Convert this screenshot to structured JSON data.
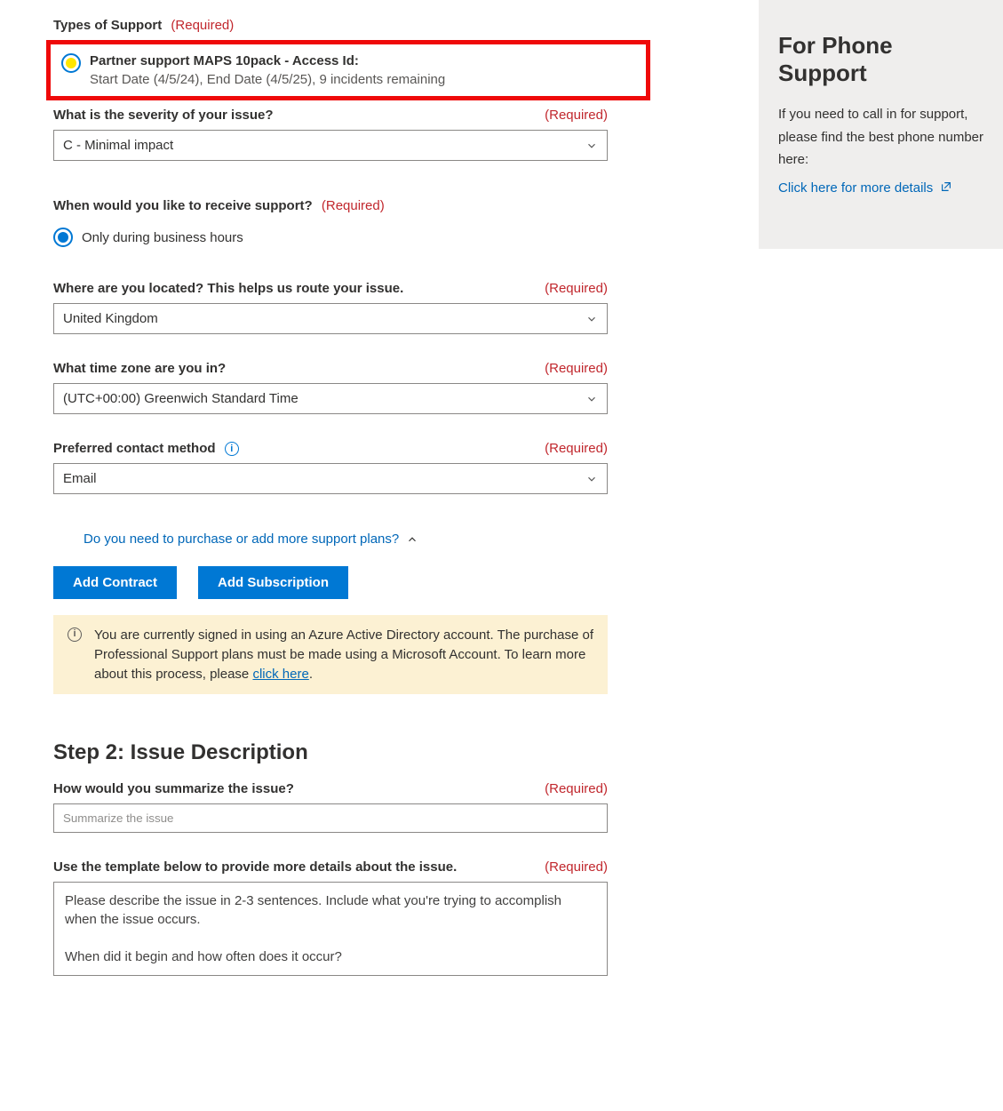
{
  "form": {
    "types_of_support_label": "Types of Support",
    "types_of_support_required": "(Required)",
    "support_option": {
      "title": "Partner support MAPS 10pack - Access Id:",
      "sub": "Start Date (4/5/24), End Date (4/5/25), 9 incidents remaining"
    },
    "severity": {
      "label": "What is the severity of your issue?",
      "required": "(Required)",
      "value": "C - Minimal impact"
    },
    "receive_support": {
      "label": "When would you like to receive support?",
      "required": "(Required)",
      "option": "Only during business hours"
    },
    "location": {
      "label": "Where are you located? This helps us route your issue.",
      "required": "(Required)",
      "value": "United Kingdom"
    },
    "timezone": {
      "label": "What time zone are you in?",
      "required": "(Required)",
      "value": "(UTC+00:00) Greenwich Standard Time"
    },
    "contact": {
      "label": "Preferred contact method",
      "required": "(Required)",
      "value": "Email"
    },
    "expand_link": "Do you need to purchase or add more support plans?",
    "buttons": {
      "add_contract": "Add Contract",
      "add_subscription": "Add Subscription"
    },
    "alert": {
      "text1": "You are currently signed in using an Azure Active Directory account. The purchase of Professional Support plans must be made using a Microsoft Account. To learn more about this process, please ",
      "link": "click here",
      "text2": "."
    },
    "step2_title": "Step 2: Issue Description",
    "summary": {
      "label": "How would you summarize the issue?",
      "required": "(Required)",
      "placeholder": "Summarize the issue"
    },
    "details": {
      "label": "Use the template below to provide more details about the issue.",
      "required": "(Required)",
      "value": "Please describe the issue in 2-3 sentences. Include what you're trying to accomplish when the issue occurs.\n\nWhen did it begin and how often does it occur?"
    }
  },
  "sidebar": {
    "title": "For Phone Support",
    "body": "If you need to call in for support, please find the best phone number here:",
    "link": "Click here for more details"
  }
}
